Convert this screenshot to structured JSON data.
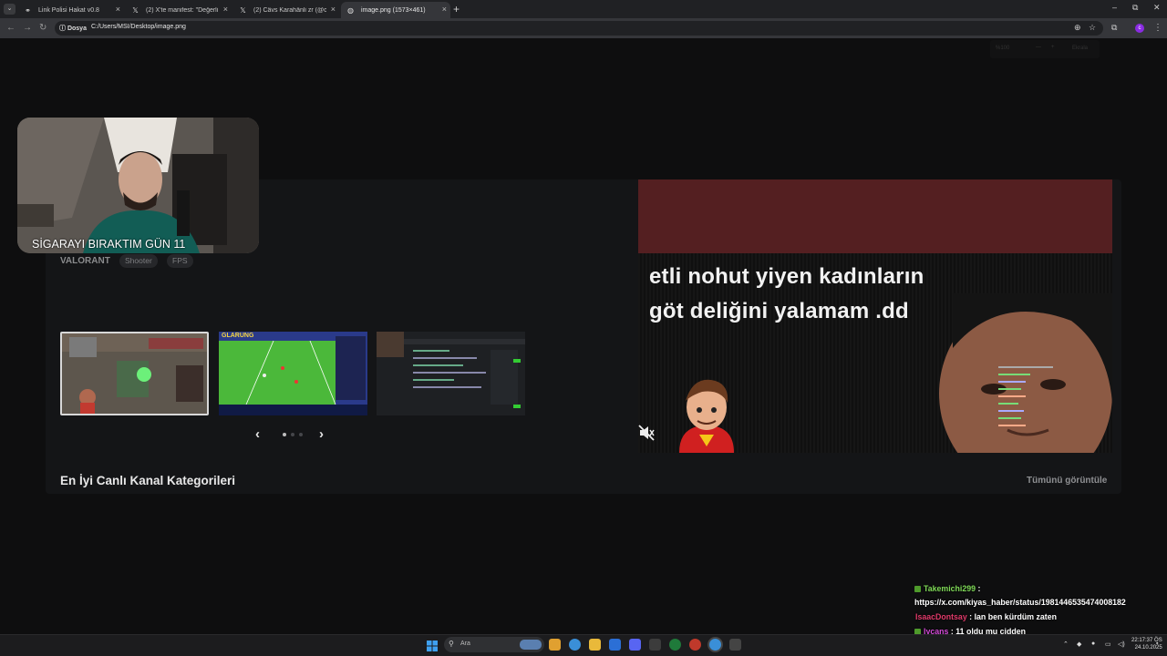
{
  "browser": {
    "tabs": [
      {
        "title": "Link Polisi Hakat v0.8",
        "icon": "link-police-icon",
        "close": "×"
      },
      {
        "title": "(2) X'te manifest: \"Değerli üyem",
        "icon": "x-logo-icon",
        "close": "×"
      },
      {
        "title": "(2) Cävs Karahânli zr (@cerrahp",
        "icon": "x-logo-icon",
        "close": "×"
      },
      {
        "title": "image.png (1573×461)",
        "icon": "globe-icon",
        "close": "×"
      }
    ],
    "new_tab": "+",
    "window_controls": {
      "minimize": "–",
      "maximize": "⧉",
      "close": "✕"
    },
    "site_chip": "Dosya",
    "url": "C:/Users/MSI/Desktop/image.png"
  },
  "page": {
    "ghost_controls": {
      "zoom": "%100",
      "minus": "—",
      "plus": "+",
      "label": "Ekrala"
    },
    "webcam_caption": "SİGARAYI BIRAKTIM GÜN 11",
    "game": {
      "title": "VALORANT",
      "tags": [
        "Shooter",
        "FPS"
      ]
    },
    "carousel": {
      "prev": "‹",
      "next": "›",
      "dots": 3,
      "active_dot": 0
    },
    "thumb2_banner": "GLARUNG",
    "video": {
      "meme_line1": "etli nohut yiyen kadınların",
      "meme_line2": "göt  deliğini yalamam .dd",
      "muted": true
    },
    "section_title": "En İyi Canlı Kanal Kategorileri",
    "view_all": "Tümünü görüntüle"
  },
  "chat": [
    {
      "user": "Takemichi299",
      "sep": " :",
      "user_color": "#7fd957",
      "badge": true,
      "message": ""
    },
    {
      "user": "",
      "sep": "",
      "user_color": "#ffffff",
      "badge": false,
      "message": "https://x.com/kiyas_haber/status/1981446535474008182"
    },
    {
      "user": "IsaacDontsay",
      "sep": " : ",
      "user_color": "#e03a6a",
      "badge": false,
      "message": "lan ben kürdüm zaten"
    },
    {
      "user": "lycans",
      "sep": " : ",
      "user_color": "#d44bd8",
      "badge": true,
      "message": "11 oldu mu cidden"
    }
  ],
  "taskbar": {
    "search_placeholder": "Ara",
    "clock_time": "22:17:37 ÖS",
    "clock_date": "24.10.2025"
  },
  "colors": {
    "accent_purple": "#8a2be2",
    "video_header": "#541f21",
    "chat_green": "#7fd957"
  }
}
